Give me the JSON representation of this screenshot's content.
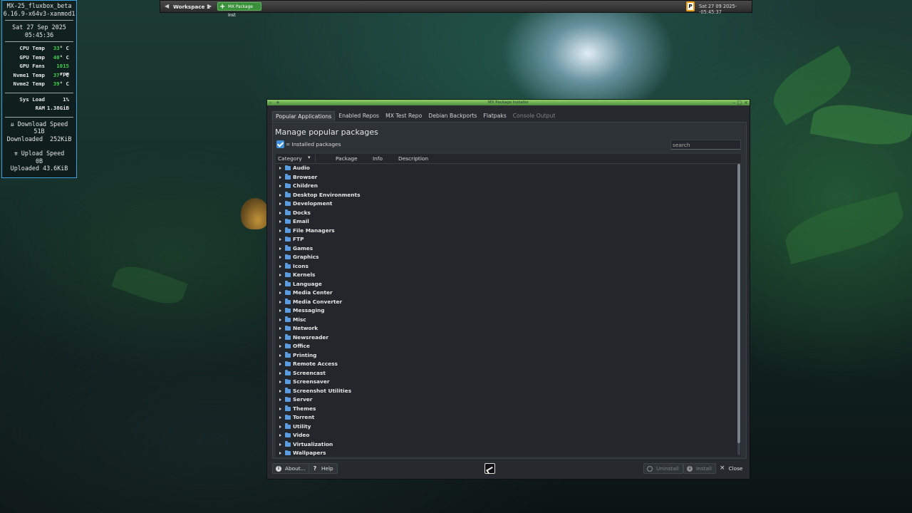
{
  "conky": {
    "host": "MX-25_fluxbox_beta",
    "kernel": "6.16.9-x64v3-xanmod1",
    "date": "Sat 27 Sep 2025",
    "time": "05:45:36",
    "stats": [
      {
        "label": "CPU Temp",
        "value": "33",
        "unit": "° C"
      },
      {
        "label": "GPU Temp",
        "value": "40",
        "unit": "° C"
      },
      {
        "label": "GPU Fans",
        "value": "1015",
        "unit": " rpm"
      },
      {
        "label": "Nvme1 Temp",
        "value": "37",
        "unit": "° C"
      },
      {
        "label": "Nvme2 Temp",
        "value": "39",
        "unit": "° C"
      }
    ],
    "sys_load_label": "Sys Load",
    "sys_load_value": "1%",
    "ram_label": "RAM",
    "ram_value": "1.38GiB",
    "download_speed_label": "⇊ Download Speed",
    "download_speed_value": "51B",
    "downloaded_label": "Downloaded",
    "downloaded_value": "252KiB",
    "upload_speed_label": "⇈ Upload Speed",
    "upload_speed_value": "0B",
    "uploaded_label": "Uploaded",
    "uploaded_value": "43.6KiB"
  },
  "taskbar": {
    "workspace": "Workspace 1",
    "task_label": "MX Package Inst",
    "tray_letter": "P",
    "clock": "Sat 27 09 2025--05:45:37"
  },
  "window": {
    "title": "MX Package Installer",
    "tabs": [
      {
        "label": "Popular Applications",
        "state": "active"
      },
      {
        "label": "Enabled Repos",
        "state": "normal"
      },
      {
        "label": "MX Test Repo",
        "state": "normal"
      },
      {
        "label": "Debian Backports",
        "state": "normal"
      },
      {
        "label": "Flatpaks",
        "state": "normal"
      },
      {
        "label": "Console Output",
        "state": "disabled"
      }
    ],
    "heading": "Manage popular packages",
    "installed_legend": "= Installed packages",
    "search_placeholder": "search",
    "columns": {
      "category": "Category",
      "package": "Package",
      "info": "Info",
      "description": "Description"
    },
    "categories": [
      "Audio",
      "Browser",
      "Children",
      "Desktop Environments",
      "Development",
      "Docks",
      "Email",
      "File Managers",
      "FTP",
      "Games",
      "Graphics",
      "Icons",
      "Kernels",
      "Language",
      "Media Center",
      "Media Converter",
      "Messaging",
      "Misc",
      "Network",
      "Newsreader",
      "Office",
      "Printing",
      "Remote Access",
      "Screencast",
      "Screensaver",
      "Screenshot Utilities",
      "Server",
      "Themes",
      "Torrent",
      "Utility",
      "Video",
      "Virtualization",
      "Wallpapers"
    ],
    "buttons": {
      "about": "About...",
      "help": "Help",
      "uninstall": "Uninstall",
      "install": "Install",
      "close": "Close"
    }
  },
  "colors": {
    "accent": "#3d8fd8",
    "titlebar": "#6bb24d",
    "conky_border": "#3aa0e0",
    "conky_value": "#3fd04a"
  }
}
